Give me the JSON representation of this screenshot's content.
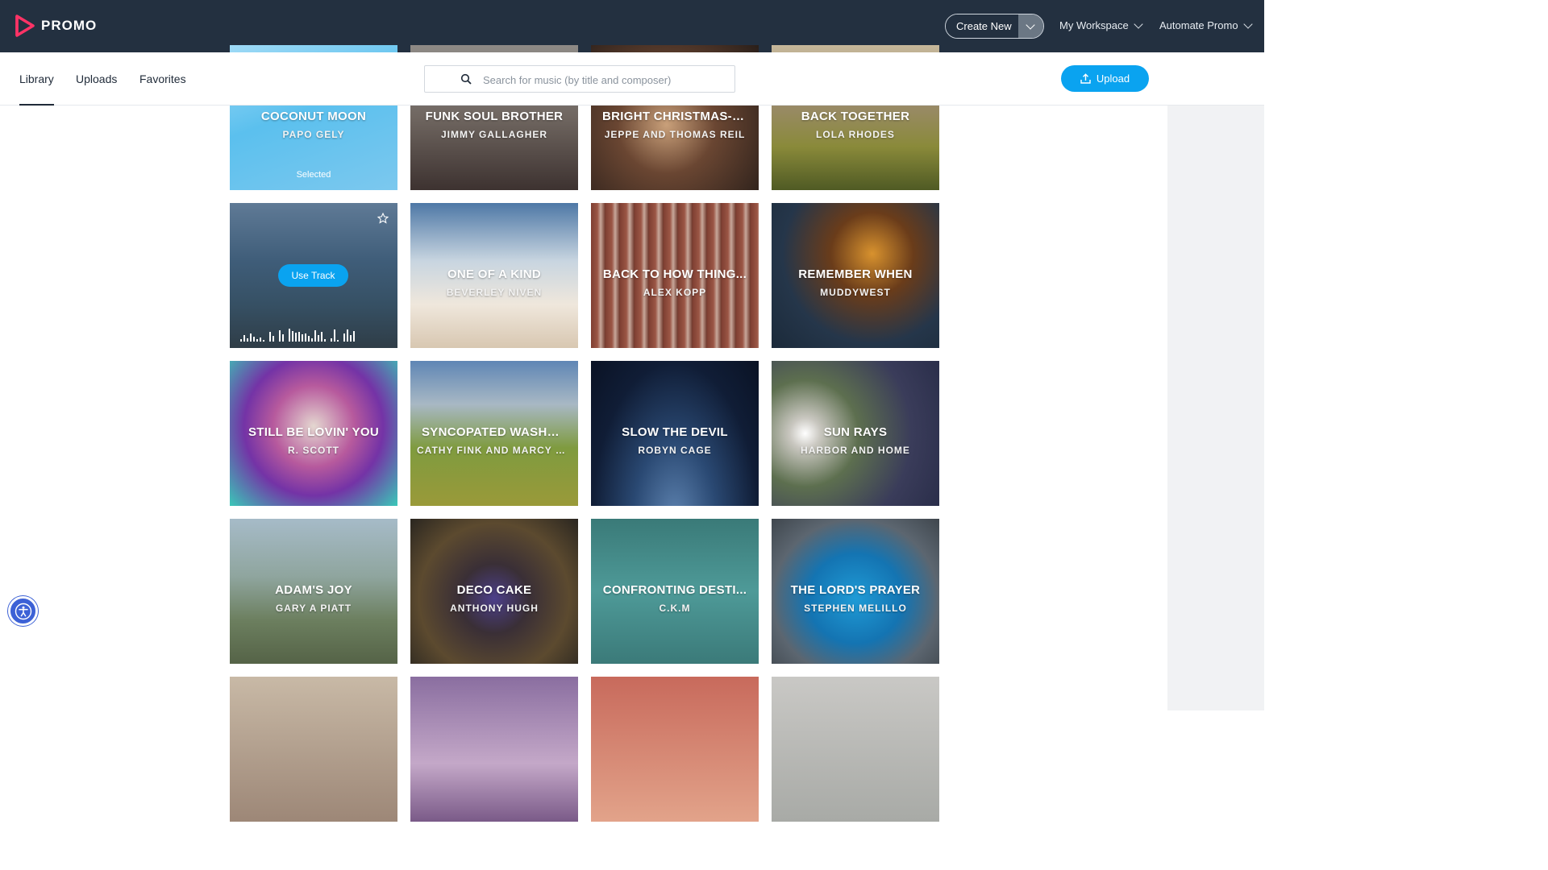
{
  "app": {
    "logo_text": "PROMO",
    "brand_color": "#ff3366"
  },
  "header": {
    "create_new": "Create New",
    "my_workspace": "My Workspace",
    "automate_promo": "Automate Promo"
  },
  "subnav": {
    "tabs": [
      {
        "label": "Library",
        "active": true
      },
      {
        "label": "Uploads",
        "active": false
      },
      {
        "label": "Favorites",
        "active": false
      }
    ],
    "search_placeholder": "Search for music (by title and composer)",
    "upload": "Upload"
  },
  "tracks": [
    {
      "title": "COCONUT MOON",
      "artist": "PAPO GELY",
      "status": "Selected"
    },
    {
      "title": "FUNK SOUL BROTHER",
      "artist": "JIMMY GALLAGHER"
    },
    {
      "title": "BRIGHT CHRISTMAS-D...",
      "artist": "JEPPE AND THOMAS REIL"
    },
    {
      "title": "BACK TOGETHER",
      "artist": "LOLA RHODES"
    },
    {
      "title": "",
      "artist": "",
      "action": "Use Track"
    },
    {
      "title": "ONE OF A KIND",
      "artist": "BEVERLEY NIVEN"
    },
    {
      "title": "BACK TO HOW THING...",
      "artist": "ALEX KOPP"
    },
    {
      "title": "REMEMBER WHEN",
      "artist": "MUDDYWEST"
    },
    {
      "title": "STILL BE LOVIN' YOU",
      "artist": "R. SCOTT"
    },
    {
      "title": "SYNCOPATED WASHB...",
      "artist": "CATHY FINK AND MARCY MA..."
    },
    {
      "title": "SLOW THE DEVIL",
      "artist": "ROBYN CAGE"
    },
    {
      "title": "SUN RAYS",
      "artist": "HARBOR AND HOME"
    },
    {
      "title": "ADAM'S JOY",
      "artist": "GARY A PIATT"
    },
    {
      "title": "DECO CAKE",
      "artist": "ANTHONY HUGH"
    },
    {
      "title": "CONFRONTING DESTI...",
      "artist": "C.K.M"
    },
    {
      "title": "THE LORD'S PRAYER",
      "artist": "STEPHEN MELILLO"
    }
  ]
}
